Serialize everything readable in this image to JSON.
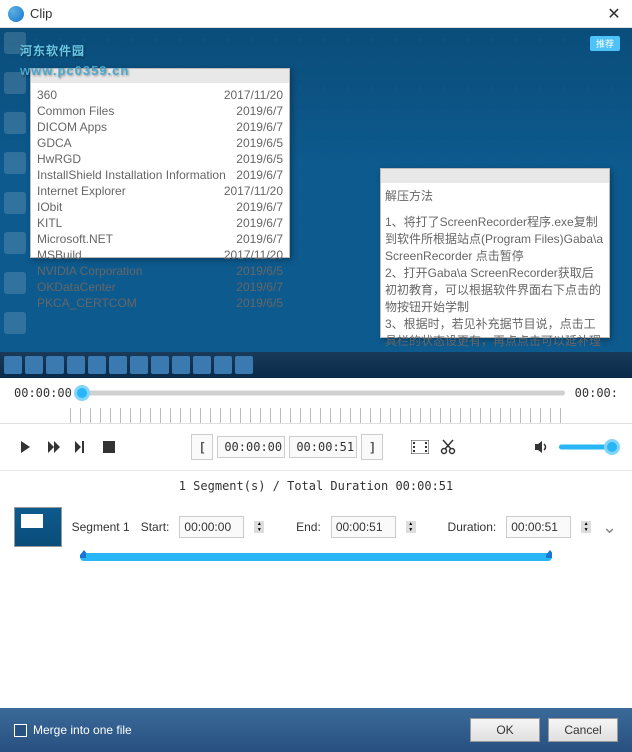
{
  "titlebar": {
    "title": "Clip"
  },
  "watermark": {
    "name": "河东软件园",
    "url": "www.pc0359.cn"
  },
  "preview_badge": "推荐",
  "timeline": {
    "start": "00:00:00",
    "end": "00:00:",
    "fill_percent": 0
  },
  "controls": {
    "start_time": "00:00:00",
    "end_time": "00:00:51"
  },
  "summary": "1 Segment(s) / Total Duration 00:00:51",
  "segment": {
    "name": "Segment 1",
    "labels": {
      "start": "Start:",
      "end": "End:",
      "duration": "Duration:"
    },
    "start": "00:00:00",
    "end": "00:00:51",
    "duration": "00:00:51"
  },
  "footer": {
    "merge_label": "Merge into one file",
    "ok": "OK",
    "cancel": "Cancel"
  },
  "volume_percent": 90
}
